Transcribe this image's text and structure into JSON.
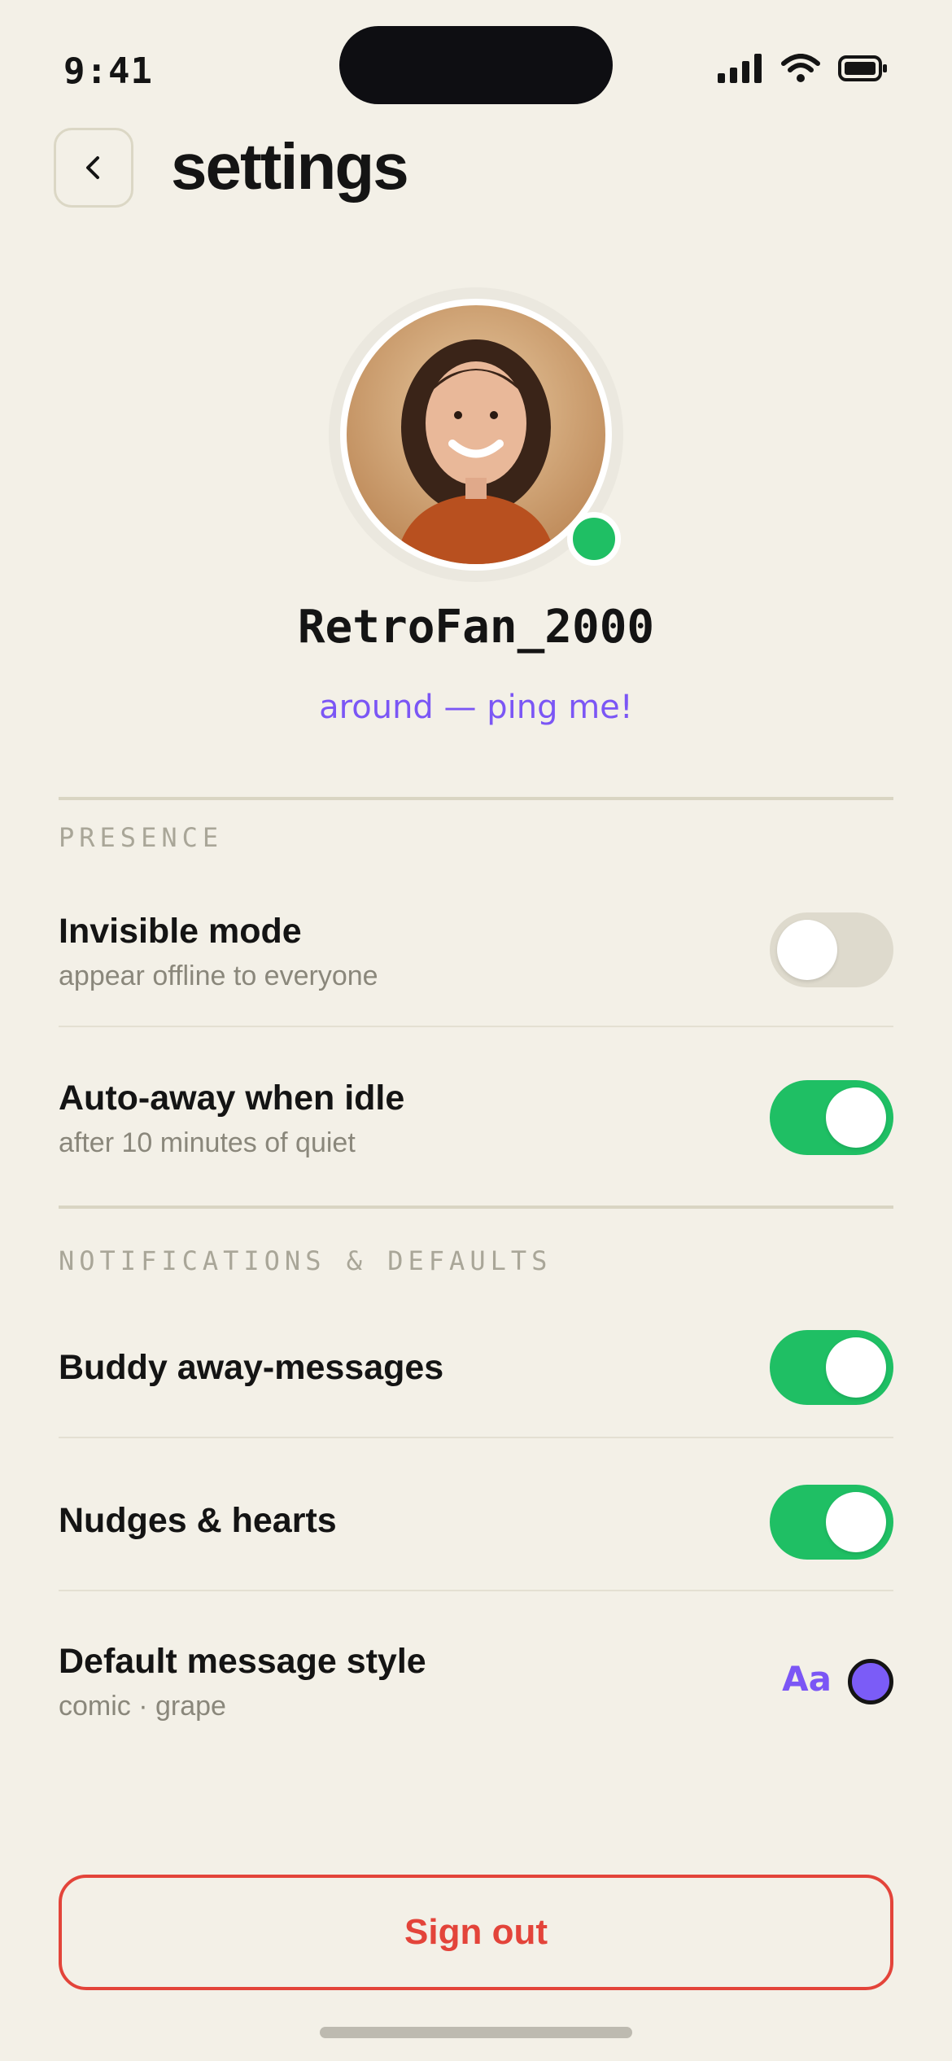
{
  "status_bar": {
    "time": "9:41"
  },
  "header": {
    "title": "settings"
  },
  "profile": {
    "username": "RetroFan_2000",
    "away_message": "around — ping me!",
    "online": true
  },
  "sections": {
    "presence": {
      "label": "PRESENCE",
      "rows": [
        {
          "title": "Invisible mode",
          "subtitle": "appear offline to everyone",
          "enabled": false
        },
        {
          "title": "Auto-away when idle",
          "subtitle": "after 10 minutes of quiet",
          "enabled": true
        }
      ]
    },
    "notifications": {
      "label": "NOTIFICATIONS & DEFAULTS",
      "rows": [
        {
          "title": "Buddy away-messages",
          "enabled": true
        },
        {
          "title": "Nudges & hearts",
          "enabled": true
        },
        {
          "title": "Default message style",
          "subtitle": "comic · grape",
          "preview": "Aa"
        }
      ]
    }
  },
  "actions": {
    "sign_out": "Sign out"
  },
  "colors": {
    "accent": "#7b56f5",
    "toggle_on": "#1fbf64",
    "danger": "#e3443a",
    "background": "#f3f0e7"
  }
}
